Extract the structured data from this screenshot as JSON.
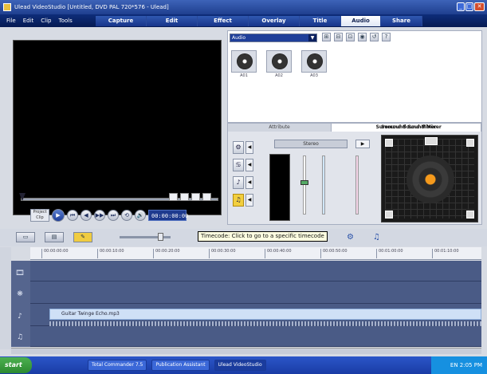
{
  "window": {
    "title": "Ulead VideoStudio [Untitled, DVD PAL 720*576 - Ulead]",
    "min": "_",
    "max": "□",
    "close": "✕"
  },
  "menu": [
    "File",
    "Edit",
    "Clip",
    "Tools"
  ],
  "steps": [
    {
      "label": "Capture",
      "w": 64
    },
    {
      "label": "Edit",
      "w": 64
    },
    {
      "label": "Effect",
      "w": 64
    },
    {
      "label": "Overlay",
      "w": 64
    },
    {
      "label": "Title",
      "w": 52
    },
    {
      "label": "Audio",
      "w": 50,
      "active": true
    },
    {
      "label": "Share",
      "w": 52
    }
  ],
  "preview": {
    "mode_label": "Project Clip",
    "timecode": "00:00:00:00",
    "buttons": [
      "⏮",
      "◀◀",
      "◀",
      "▶",
      "▶▶",
      "⏭",
      "⟲",
      "🔊"
    ]
  },
  "library": {
    "dropdown": "Audio",
    "tools": [
      "⊞",
      "⊟",
      "⊡",
      "◉",
      "↺",
      "?"
    ],
    "thumbs": [
      "A01",
      "A02",
      "A03"
    ]
  },
  "options": {
    "tabs": [
      {
        "label": "Attribute",
        "w": 130
      },
      {
        "label": "Surround Sound Mixer",
        "w": 188,
        "active": true
      }
    ],
    "stereo_label": "Stereo",
    "play_label": "▶",
    "surround_title": "Surround Sound Mixer",
    "tracks": [
      {
        "icon": "⚙",
        "name": "video-track"
      },
      {
        "icon": "♋",
        "name": "overlay-track"
      },
      {
        "icon": "♪",
        "name": "voice-track"
      },
      {
        "icon": "♫",
        "name": "music-track",
        "music": true
      }
    ]
  },
  "timeline_toolbar": {
    "buttons": [
      "▭",
      "▤",
      "✎"
    ],
    "tooltip": "Timecode: Click to go to a specific timecode",
    "icons": [
      "⚙",
      "♫"
    ]
  },
  "ruler": {
    "ticks": [
      "00:00:00:00",
      "00:00:10:00",
      "00:00:20:00",
      "00:00:30:00",
      "00:00:40:00",
      "00:00:50:00",
      "00:01:00:00",
      "00:01:10:00",
      "00:01:20:00"
    ]
  },
  "timeline": {
    "audio_clip": "Guitar Twinge Echo.mp3",
    "headers": [
      "🎞",
      "❋",
      "♪",
      "♫"
    ]
  },
  "taskbar": {
    "start": "start",
    "tasks": [
      "Total Commander 7.5",
      "Publication Assistant",
      "Ulead VideoStudio"
    ],
    "clock": "EN 2:05 PM"
  }
}
